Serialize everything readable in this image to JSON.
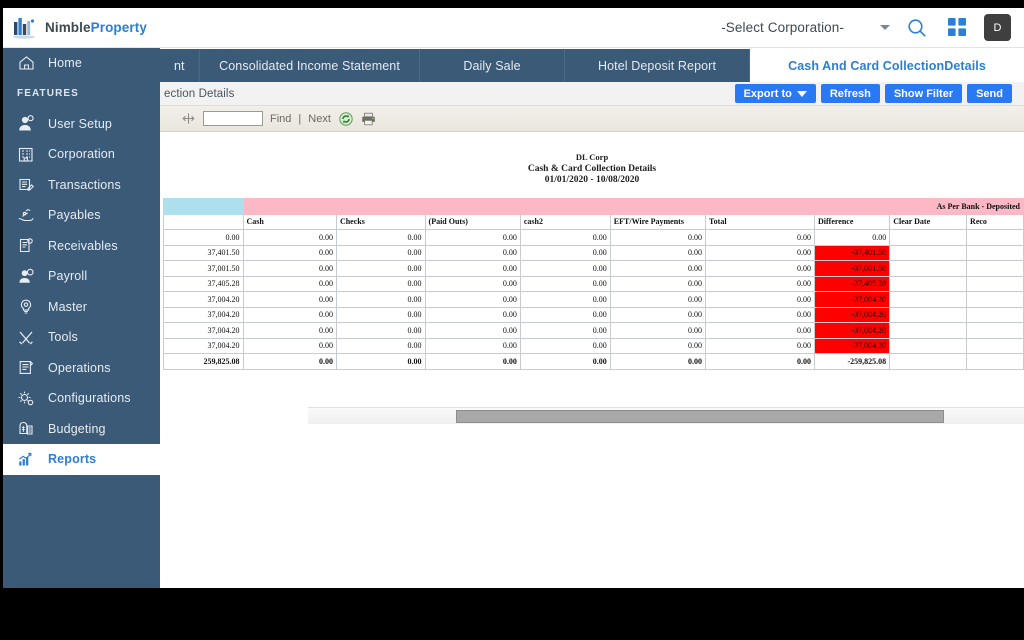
{
  "brand": {
    "name_part1": "Nimble",
    "name_part2": "Property",
    "logo_icon": "building-bars-logo"
  },
  "sidebar": {
    "section_label": "FEATURES",
    "home": {
      "label": "Home",
      "icon": "home-icon"
    },
    "items": [
      {
        "label": "User Setup",
        "icon": "user-setup-icon"
      },
      {
        "label": "Corporation",
        "icon": "building-icon"
      },
      {
        "label": "Transactions",
        "icon": "transactions-icon"
      },
      {
        "label": "Payables",
        "icon": "payables-icon"
      },
      {
        "label": "Receivables",
        "icon": "receivables-icon"
      },
      {
        "label": "Payroll",
        "icon": "payroll-icon"
      },
      {
        "label": "Master",
        "icon": "master-bulb-icon"
      },
      {
        "label": "Tools",
        "icon": "tools-icon"
      },
      {
        "label": "Operations",
        "icon": "operations-icon"
      },
      {
        "label": "Configurations",
        "icon": "configurations-gear-icon"
      },
      {
        "label": "Budgeting",
        "icon": "budgeting-money-icon"
      },
      {
        "label": "Reports",
        "icon": "reports-chart-icon",
        "active": true
      }
    ]
  },
  "header": {
    "corporation_selected": "-Select Corporation-",
    "search_icon": "search-icon",
    "apps_icon": "grid-apps-icon",
    "avatar_initial": "D"
  },
  "tabs": [
    {
      "label": "nt",
      "active": false
    },
    {
      "label": "Consolidated Income Statement",
      "active": false
    },
    {
      "label": "Daily Sale",
      "active": false
    },
    {
      "label": "Hotel Deposit Report",
      "active": false
    },
    {
      "label": "Cash And Card CollectionDetails",
      "active": true
    }
  ],
  "actionbar": {
    "breadcrumb": "ection Details",
    "export_label": "Export to",
    "refresh_label": "Refresh",
    "show_filter_label": "Show Filter",
    "send_label": "Send"
  },
  "report_toolbar": {
    "nav_icon": "page-navigation-icon",
    "find_value": "",
    "find_label": "Find",
    "separator": "|",
    "next_label": "Next",
    "refresh_icon": "refresh-icon",
    "print_icon": "print-icon"
  },
  "report": {
    "company": "DL Corp",
    "title": "Cash & Card Collection Details",
    "date_range": "01/01/2020 - 10/08/2020"
  },
  "colors": {
    "sidebar": "#3b5a78",
    "accent_blue": "#2b7fd4",
    "button_blue": "#2979f7",
    "band_blue": "#ade0ec",
    "band_pink": "#fcb8c4",
    "alert_red": "#fe0000"
  },
  "chart_data": {
    "type": "table",
    "title": "Cash & Card Collection Details",
    "band_label": "As Per Bank - Deposited",
    "columns": [
      "",
      "Cash",
      "Checks",
      "(Paid Outs)",
      "cash2",
      "EFT/Wire Payments",
      "Total",
      "Difference",
      "Clear Date",
      "Reco"
    ],
    "rows": [
      {
        "cells": [
          "0.00",
          "0.00",
          "0.00",
          "0.00",
          "0.00",
          "0.00",
          "0.00",
          "0.00",
          "",
          ""
        ],
        "diff_red": false
      },
      {
        "cells": [
          "37,401.50",
          "0.00",
          "0.00",
          "0.00",
          "0.00",
          "0.00",
          "0.00",
          "-37,401.50",
          "",
          ""
        ],
        "diff_red": true
      },
      {
        "cells": [
          "37,001.50",
          "0.00",
          "0.00",
          "0.00",
          "0.00",
          "0.00",
          "0.00",
          "-37,001.50",
          "",
          ""
        ],
        "diff_red": true
      },
      {
        "cells": [
          "37,405.28",
          "0.00",
          "0.00",
          "0.00",
          "0.00",
          "0.00",
          "0.00",
          "-37,405.28",
          "",
          ""
        ],
        "diff_red": true
      },
      {
        "cells": [
          "37,004.20",
          "0.00",
          "0.00",
          "0.00",
          "0.00",
          "0.00",
          "0.00",
          "-37,004.20",
          "",
          ""
        ],
        "diff_red": true
      },
      {
        "cells": [
          "37,004.20",
          "0.00",
          "0.00",
          "0.00",
          "0.00",
          "0.00",
          "0.00",
          "-37,004.20",
          "",
          ""
        ],
        "diff_red": true
      },
      {
        "cells": [
          "37,004.20",
          "0.00",
          "0.00",
          "0.00",
          "0.00",
          "0.00",
          "0.00",
          "-37,004.20",
          "",
          ""
        ],
        "diff_red": true
      },
      {
        "cells": [
          "37,004.20",
          "0.00",
          "0.00",
          "0.00",
          "0.00",
          "0.00",
          "0.00",
          "-37,004.20",
          "",
          ""
        ],
        "diff_red": true
      }
    ],
    "total_row": {
      "cells": [
        "259,825.08",
        "0.00",
        "0.00",
        "0.00",
        "0.00",
        "0.00",
        "0.00",
        "-259,825.08",
        "",
        ""
      ]
    }
  }
}
